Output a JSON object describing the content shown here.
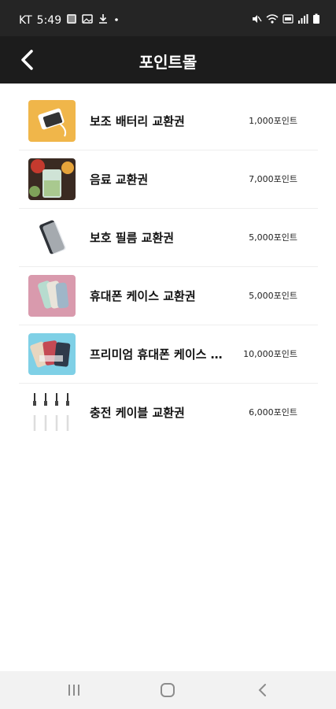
{
  "status_bar": {
    "carrier": "KT",
    "time": "5:49"
  },
  "header": {
    "title": "포인트몰",
    "back_icon": "chevron-left-icon"
  },
  "items": [
    {
      "name": "보조 배터리 교환권",
      "points": "1,000포인트"
    },
    {
      "name": "음료 교환권",
      "points": "7,000포인트"
    },
    {
      "name": "보호 필름 교환권",
      "points": "5,000포인트"
    },
    {
      "name": "휴대폰 케이스 교환권",
      "points": "5,000포인트"
    },
    {
      "name": "프리미엄 휴대폰 케이스 교환권",
      "points": "10,000포인트"
    },
    {
      "name": "충전 케이블 교환권",
      "points": "6,000포인트"
    }
  ],
  "nav_bar": {
    "recents_icon": "recents-icon",
    "home_icon": "home-icon",
    "back_icon": "back-icon"
  }
}
